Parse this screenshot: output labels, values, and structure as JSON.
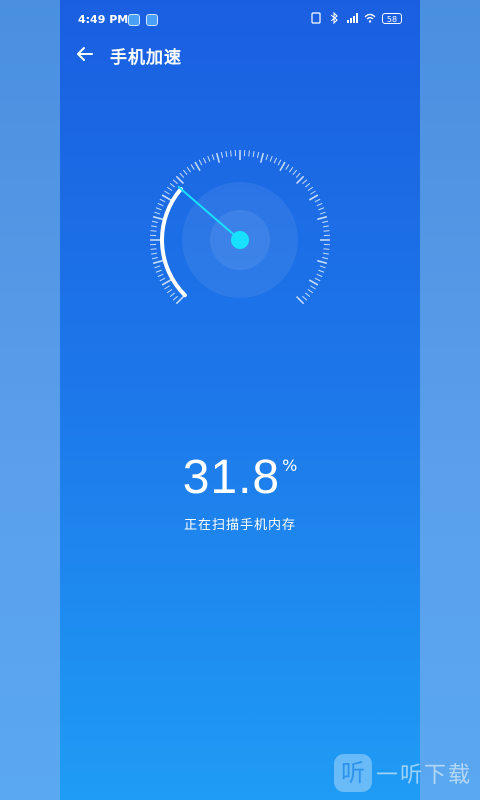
{
  "status_bar": {
    "time": "4:49 PM",
    "battery": "58",
    "icons": [
      "telegram-icon",
      "telegram-icon",
      "sim-icon",
      "bluetooth-icon",
      "signal-icon",
      "wifi-icon",
      "battery-icon"
    ]
  },
  "header": {
    "back_icon": "arrow-left-icon",
    "title": "手机加速"
  },
  "gauge": {
    "level": 0.318,
    "accent_color": "#19e0ff"
  },
  "readout": {
    "value": "31.8",
    "unit": "%",
    "status": "正在扫描手机内存"
  },
  "watermark": {
    "logo_char": "听",
    "text": "一听下载"
  },
  "colors": {
    "background_top": "#1a5fe0",
    "background_bottom": "#1f9cf5",
    "needle": "#19e0ff"
  }
}
